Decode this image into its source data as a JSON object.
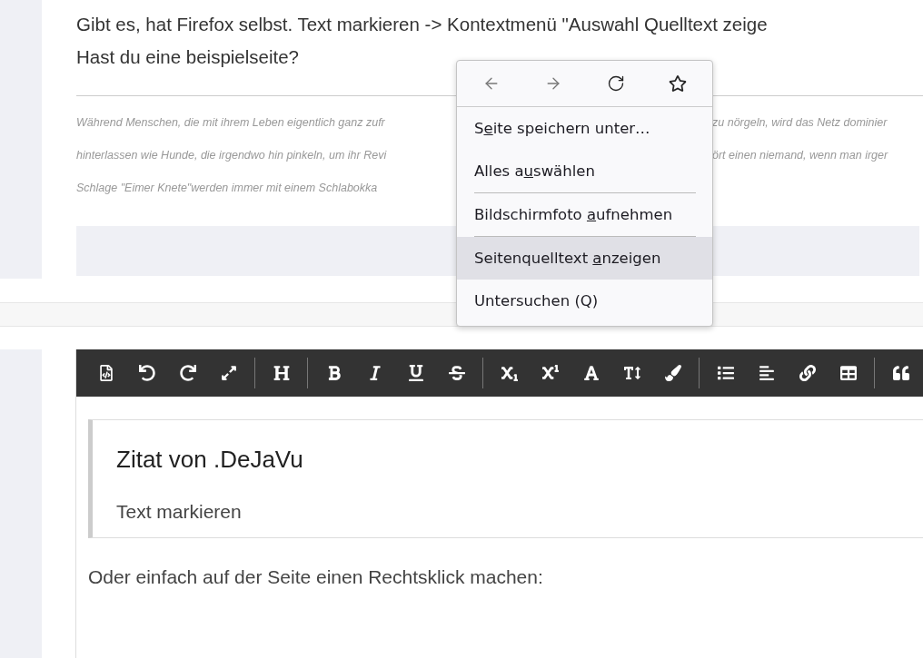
{
  "post": {
    "lines": [
      "Gibt es, hat Firefox selbst. Text markieren -> Kontextmenü \"Auswahl Quelltext zeige",
      "Hast du eine beispielseite?"
    ],
    "signature": [
      {
        "left": "Während Menschen, die mit ihrem Leben eigentlich ganz zufr",
        "right": "zu nörgeln, wird das Netz dominier"
      },
      {
        "left": "hinterlassen wie Hunde, die irgendwo hin pinkeln, um ihr Revi",
        "right": "ört einen niemand, wenn man irger"
      },
      {
        "left": "Schlage \"Eimer Knete\"werden immer mit einem Schlabokka"
      }
    ]
  },
  "context_menu": {
    "nav": [
      {
        "kind": "back",
        "disabled": true
      },
      {
        "kind": "forward",
        "disabled": true
      },
      {
        "kind": "reload",
        "disabled": false
      },
      {
        "kind": "bookmark",
        "disabled": false
      }
    ],
    "items": [
      {
        "kind": "item",
        "before": "S",
        "key": "e",
        "after": "ite speichern unter…",
        "selected": false
      },
      {
        "kind": "item",
        "before": "Alles a",
        "key": "u",
        "after": "swählen",
        "selected": false
      },
      {
        "kind": "separator"
      },
      {
        "kind": "item",
        "before": "Bildschirmfoto ",
        "key": "a",
        "after": "ufnehmen",
        "selected": false
      },
      {
        "kind": "separator"
      },
      {
        "kind": "item",
        "before": "Seitenquelltext ",
        "key": "a",
        "after": "nzeigen",
        "selected": true
      },
      {
        "kind": "item",
        "before": "Untersuchen (Q)",
        "selected": false
      }
    ]
  },
  "editor": {
    "quote": {
      "author": "Zitat von .DeJaVu",
      "text": "Text markieren"
    },
    "text": "Oder einfach auf der Seite einen Rechtsklick machen:"
  }
}
